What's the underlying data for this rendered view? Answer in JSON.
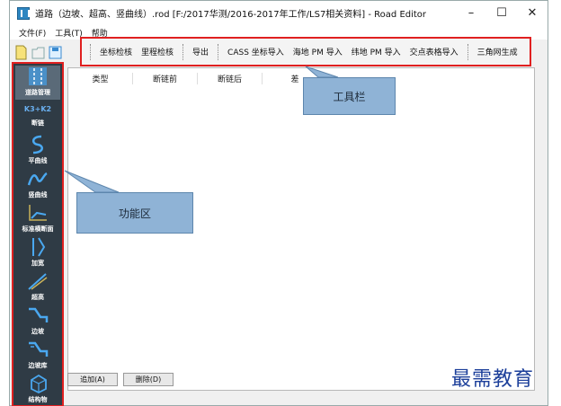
{
  "window": {
    "title": "道路（边坡、超高、竖曲线）.rod [F:/2017华测/2016-2017年工作/LS7相关资料] - Road Editor",
    "controls": {
      "minimize": "–",
      "maximize": "☐",
      "close": "✕"
    }
  },
  "menu": {
    "file": "文件(F)",
    "tools": "工具(T)",
    "help": "帮助"
  },
  "toolbar": {
    "coord_check": "坐标检核",
    "mileage_check": "里程检核",
    "export": "导出",
    "cass_import": "CASS 坐标导入",
    "haidi_import": "海地 PM 导入",
    "weidi_import": "纬地 PM 导入",
    "intersection_import": "交点表格导入",
    "tin_generate": "三角网生成"
  },
  "sidebar": {
    "items": [
      {
        "label": "道路管理",
        "icon": "road-manage-icon"
      },
      {
        "label": "断链",
        "icon": "chain-break-icon",
        "text": "K3+K2"
      },
      {
        "label": "平曲线",
        "icon": "horizontal-curve-icon"
      },
      {
        "label": "竖曲线",
        "icon": "vertical-curve-icon"
      },
      {
        "label": "标准横断面",
        "icon": "cross-section-icon"
      },
      {
        "label": "加宽",
        "icon": "widen-icon"
      },
      {
        "label": "超高",
        "icon": "superelevation-icon"
      },
      {
        "label": "边坡",
        "icon": "slope-icon"
      },
      {
        "label": "边坡库",
        "icon": "slope-library-icon"
      },
      {
        "label": "结构物",
        "icon": "structure-icon"
      }
    ]
  },
  "table": {
    "headers": [
      "类型",
      "断链前",
      "断链后",
      "差"
    ]
  },
  "buttons": {
    "add": "追加(A)",
    "delete": "删除(D)"
  },
  "annotations": {
    "toolbar": "工具栏",
    "function_area": "功能区"
  },
  "watermark": "最需教育",
  "colors": {
    "highlight": "#e02020",
    "callout": "#8fb3d6",
    "sidebar": "#2f3b45"
  }
}
